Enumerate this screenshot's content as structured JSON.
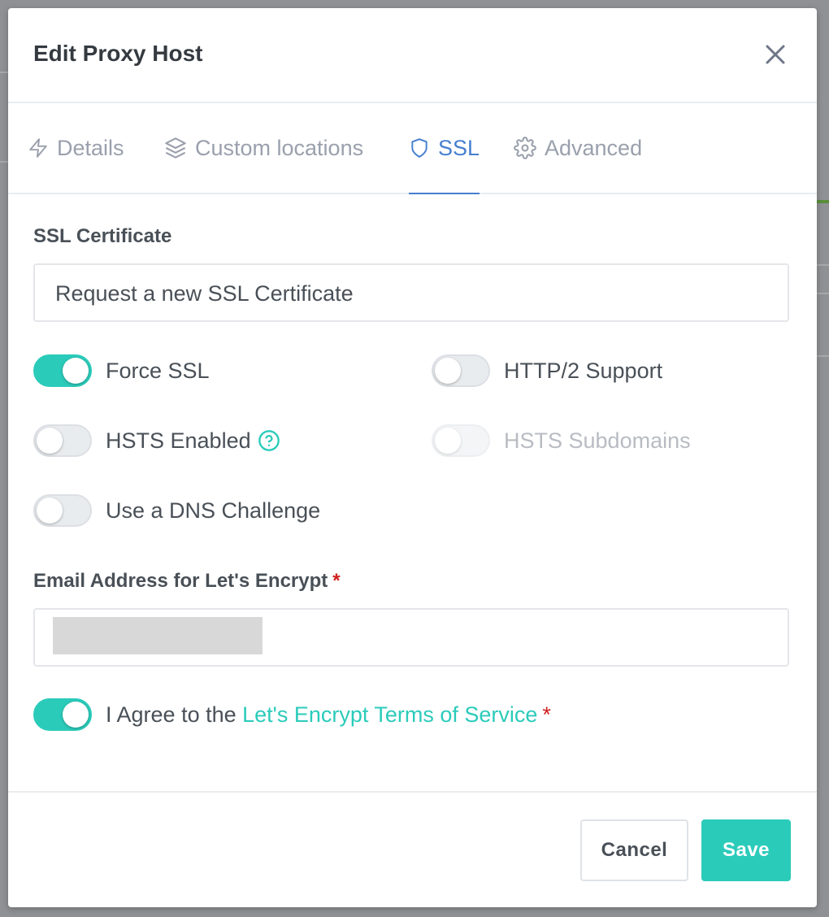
{
  "modal": {
    "title": "Edit Proxy Host"
  },
  "tabs": [
    {
      "label": "Details",
      "icon": "lightning-icon",
      "active": false
    },
    {
      "label": "Custom locations",
      "icon": "layers-icon",
      "active": false
    },
    {
      "label": "SSL",
      "icon": "shield-icon",
      "active": true
    },
    {
      "label": "Advanced",
      "icon": "gear-icon",
      "active": false
    }
  ],
  "ssl": {
    "certificate_label": "SSL Certificate",
    "certificate_value": "Request a new SSL Certificate",
    "toggles": {
      "force_ssl": {
        "label": "Force SSL",
        "on": true
      },
      "http2": {
        "label": "HTTP/2 Support",
        "on": false
      },
      "hsts": {
        "label": "HSTS Enabled",
        "on": false
      },
      "hsts_sub": {
        "label": "HSTS Subdomains",
        "on": false,
        "disabled": true
      },
      "dns": {
        "label": "Use a DNS Challenge",
        "on": false
      }
    },
    "email_label": "Email Address for Let's Encrypt",
    "required_mark": "*",
    "agree_prefix": "I Agree to the ",
    "agree_link": "Let's Encrypt Terms of Service",
    "agree_on": true
  },
  "footer": {
    "cancel_label": "Cancel",
    "save_label": "Save"
  },
  "colors": {
    "accent": "#2bcbba",
    "active_tab": "#467fcf",
    "required": "#cd201f"
  }
}
